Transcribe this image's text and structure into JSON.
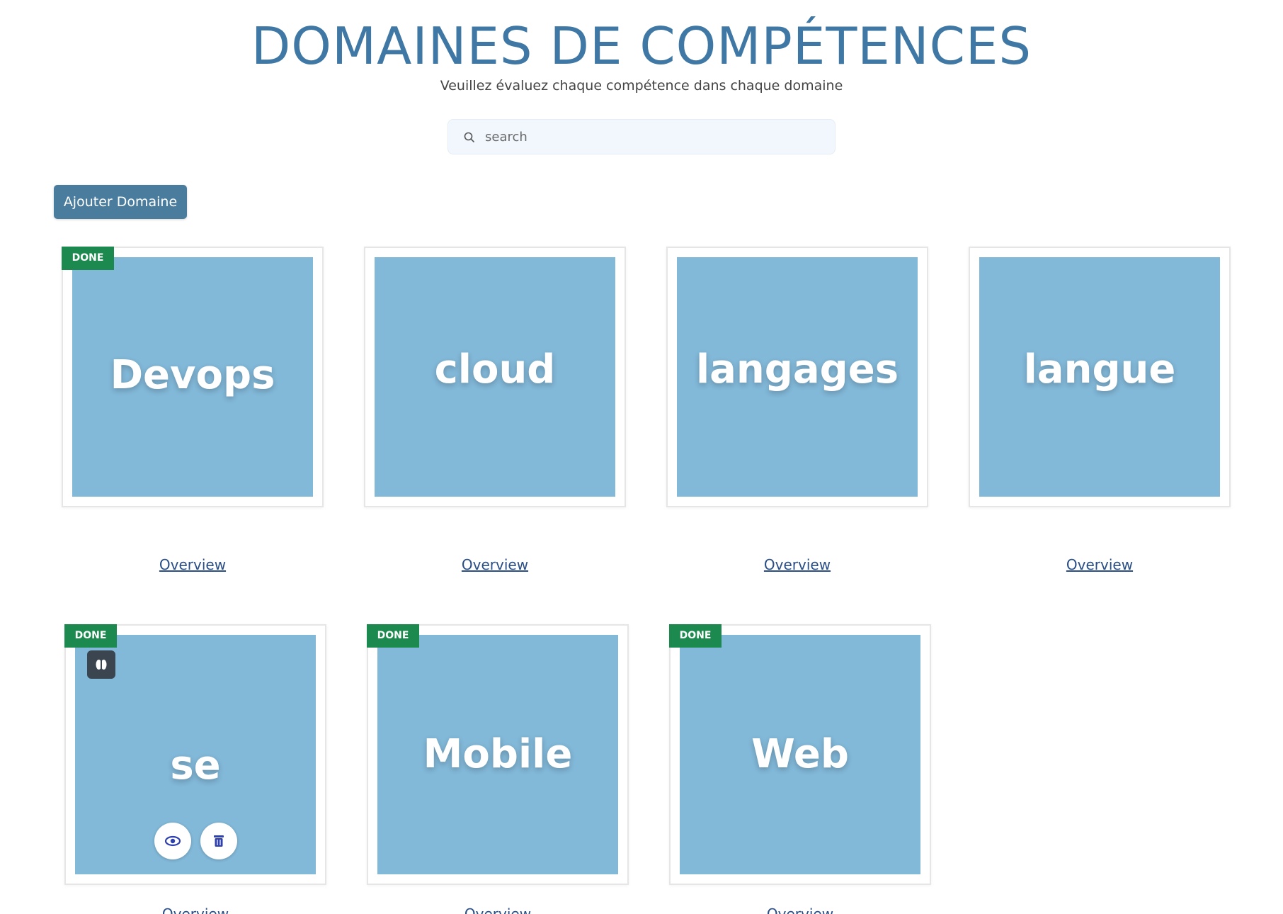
{
  "header": {
    "title": "DOMAINES DE COMPÉTENCES",
    "subtitle": "Veuillez évaluez chaque compétence dans chaque domaine"
  },
  "search": {
    "placeholder": "search",
    "value": "",
    "icon": "search-icon"
  },
  "toolbar": {
    "add_label": "Ajouter Domaine"
  },
  "colors": {
    "title": "#3f78a4",
    "tile": "#82b8d8",
    "badge": "#1c8a4e",
    "button": "#4a7c9e",
    "link": "#2a4f86"
  },
  "domains": [
    {
      "name": "Devops",
      "badge": "DONE",
      "link": "Overview"
    },
    {
      "name": "cloud",
      "badge": "",
      "link": "Overview"
    },
    {
      "name": "langages",
      "badge": "",
      "link": "Overview"
    },
    {
      "name": "langue",
      "badge": "",
      "link": "Overview"
    },
    {
      "name": "se",
      "badge": "DONE",
      "link": "Overview",
      "actions": [
        "toggle-icon",
        "eye-icon",
        "trash-icon"
      ]
    },
    {
      "name": "Mobile",
      "badge": "DONE",
      "link": "Overview"
    },
    {
      "name": "Web",
      "badge": "DONE",
      "link": "Overview"
    }
  ]
}
